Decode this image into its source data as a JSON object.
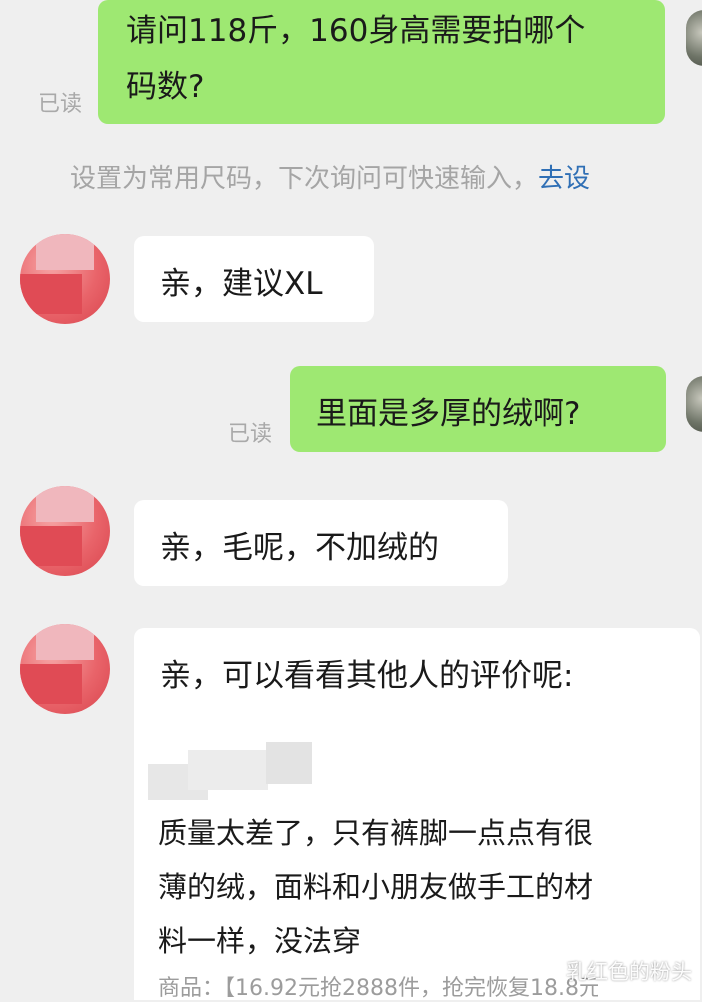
{
  "messages": [
    {
      "side": "sent",
      "text_line1": "请问118斤，160身高需要拍哪个",
      "text_line2": "码数?",
      "read": "已读"
    },
    {
      "side": "notice",
      "text": "设置为常用尺码，下次询问可快速输入，",
      "link": "去设"
    },
    {
      "side": "recv",
      "text": "亲，建议XL"
    },
    {
      "side": "sent",
      "text": "里面是多厚的绒啊?",
      "read": "已读"
    },
    {
      "side": "recv",
      "text": "亲，毛呢，不加绒的"
    },
    {
      "side": "recv",
      "heading": "亲，可以看看其他人的评价呢:",
      "review_lines": [
        "质量太差了，只有裤脚一点点有很",
        "薄的绒，面料和小朋友做手工的材",
        "料一样，没法穿"
      ],
      "product": "商品：【16.92元抢2888件，抢完恢复18.8元"
    }
  ],
  "watermark": "乳红色的粉头",
  "watermark_icon": "wechat-channel-icon",
  "colors": {
    "sent_bubble": "#9ee872",
    "recv_bubble": "#ffffff",
    "link": "#2f6fb5",
    "background": "#efefef"
  }
}
